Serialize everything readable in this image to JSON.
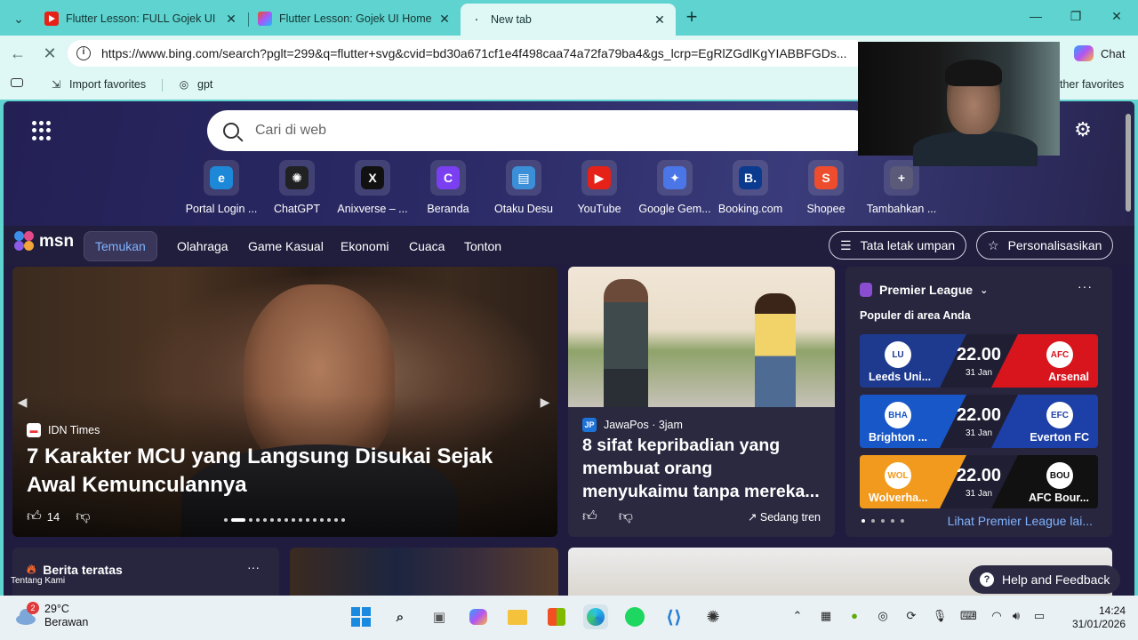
{
  "browser": {
    "tabs": [
      {
        "title": "Flutter Lesson: FULL Gojek UI Hom",
        "favicon": "youtube-icon"
      },
      {
        "title": "Flutter Lesson: Gojek UI Home Scr",
        "favicon": "figma-icon"
      },
      {
        "title": "New tab",
        "favicon": "loading-icon"
      }
    ],
    "url": "https://www.bing.com/search?pglt=299&q=flutter+svg&cvid=bd30a671cf1e4f498caa74a72fa79ba4&gs_lcrp=EgRlZGdlKgYIABBFGDs...",
    "chat_label": "Chat",
    "favorites": [
      {
        "label": "Import favorites",
        "icon": "import-icon"
      },
      {
        "label": "gpt",
        "icon": "globe-icon"
      }
    ],
    "other_favorites": "ther favorites"
  },
  "newtab": {
    "search_placeholder": "Cari di web",
    "quick_links": [
      {
        "label": "Portal Login ...",
        "icon": "ie-icon",
        "color": "#1d87d8",
        "glyph": "e"
      },
      {
        "label": "ChatGPT",
        "icon": "chatgpt-icon",
        "color": "#202123",
        "glyph": "✺"
      },
      {
        "label": "Anixverse – ...",
        "icon": "anixverse-icon",
        "color": "#111111",
        "glyph": "X"
      },
      {
        "label": "Beranda",
        "icon": "canva-icon",
        "color": "#7b3ff2",
        "glyph": "C"
      },
      {
        "label": "Otaku Desu",
        "icon": "otakudesu-icon",
        "color": "#3b8fd8",
        "glyph": "▤"
      },
      {
        "label": "YouTube",
        "icon": "youtube-icon",
        "color": "#e62117",
        "glyph": "▶"
      },
      {
        "label": "Google Gem...",
        "icon": "gemini-icon",
        "color": "#4b76e8",
        "glyph": "✦"
      },
      {
        "label": "Booking.com",
        "icon": "booking-icon",
        "color": "#0b3b8f",
        "glyph": "B."
      },
      {
        "label": "Shopee",
        "icon": "shopee-icon",
        "color": "#ee4d2d",
        "glyph": "S"
      },
      {
        "label": "Tambahkan ...",
        "icon": "plus-icon",
        "color": "#5b5a78",
        "glyph": "+"
      }
    ]
  },
  "msn": {
    "logo": "msn",
    "nav": [
      "Temukan",
      "Olahraga",
      "Game Kasual",
      "Ekonomi",
      "Cuaca",
      "Tonton"
    ],
    "feed_layout": "Tata letak umpan",
    "personalize": "Personalisasikan",
    "hero": {
      "source": "IDN Times",
      "title": "7 Karakter MCU yang Langsung Disukai Sejak Awal Kemunculannya",
      "likes": "14"
    },
    "story2": {
      "source": "JawaPos · 3jam",
      "title": "8 sifat kepribadian yang membuat orang menyukaimu tanpa mereka...",
      "trend": "Sedang tren"
    },
    "sports": {
      "league": "Premier League",
      "subtitle": "Populer di area Anda",
      "matches": [
        {
          "home": "Leeds Uni...",
          "away": "Arsenal",
          "time": "22.00",
          "date": "31 Jan",
          "home_color": "#1d3a8f",
          "away_color": "#d8141c",
          "home_crest": "LU",
          "away_crest": "AFC"
        },
        {
          "home": "Brighton ...",
          "away": "Everton FC",
          "time": "22.00",
          "date": "31 Jan",
          "home_color": "#1857c7",
          "away_color": "#1d3fa8",
          "home_crest": "BHA",
          "away_crest": "EFC"
        },
        {
          "home": "Wolverha...",
          "away": "AFC Bour...",
          "time": "22.00",
          "date": "31 Jan",
          "home_color": "#f29a1d",
          "away_color": "#111111",
          "home_crest": "WOL",
          "away_crest": "BOU"
        }
      ],
      "see_all": "Lihat Premier League lai..."
    },
    "top_news": "Berita teratas",
    "about": "Tentang Kami",
    "feedback": "Help and Feedback"
  },
  "taskbar": {
    "temperature": "29°C",
    "condition": "Berawan",
    "weather_badge": "2",
    "time": "14:24",
    "date": "31/01/2026"
  }
}
